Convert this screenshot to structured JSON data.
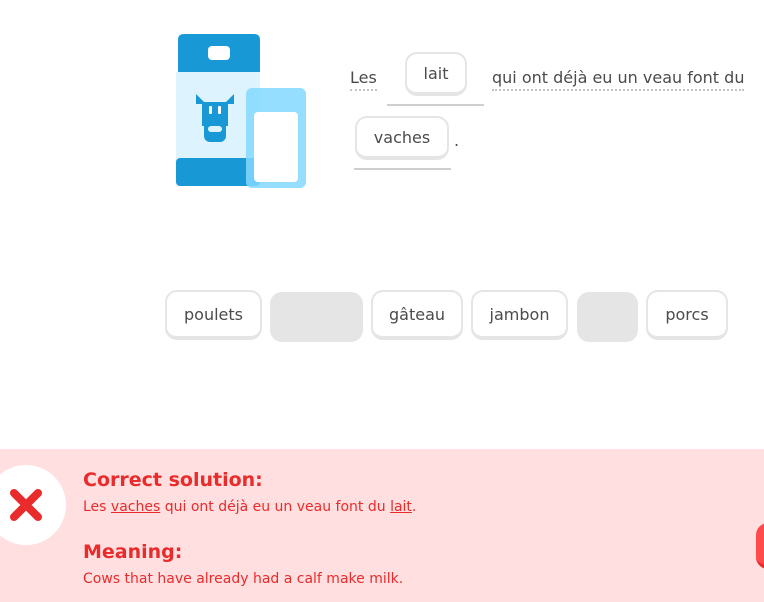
{
  "exercise": {
    "sentence": {
      "word_les": "Les",
      "slot1_word": "lait",
      "middle_text": "qui ont déjà eu un veau font du",
      "slot2_word": "vaches",
      "period": "."
    },
    "word_bank": [
      {
        "label": "poulets",
        "empty": false
      },
      {
        "label": "",
        "empty": true
      },
      {
        "label": "gâteau",
        "empty": false
      },
      {
        "label": "jambon",
        "empty": false
      },
      {
        "label": "",
        "empty": true
      },
      {
        "label": "porcs",
        "empty": false
      }
    ]
  },
  "feedback": {
    "status": "incorrect",
    "solution_heading": "Correct solution:",
    "solution": {
      "part1": "Les ",
      "highlight1": "vaches",
      "part2": " qui ont déjà eu un veau font du ",
      "highlight2": "lait",
      "part3": "."
    },
    "meaning_heading": "Meaning:",
    "meaning_text": "Cows that have already had a calf make milk.",
    "colors": {
      "error_red": "#ea2b2b",
      "error_bg": "#ffdfe0",
      "milk_blue": "#1899d6",
      "glass_blue": "#84d8ff"
    }
  },
  "icons": {
    "illustration": "milk-carton-and-glass",
    "status_icon": "x-mark-icon"
  }
}
